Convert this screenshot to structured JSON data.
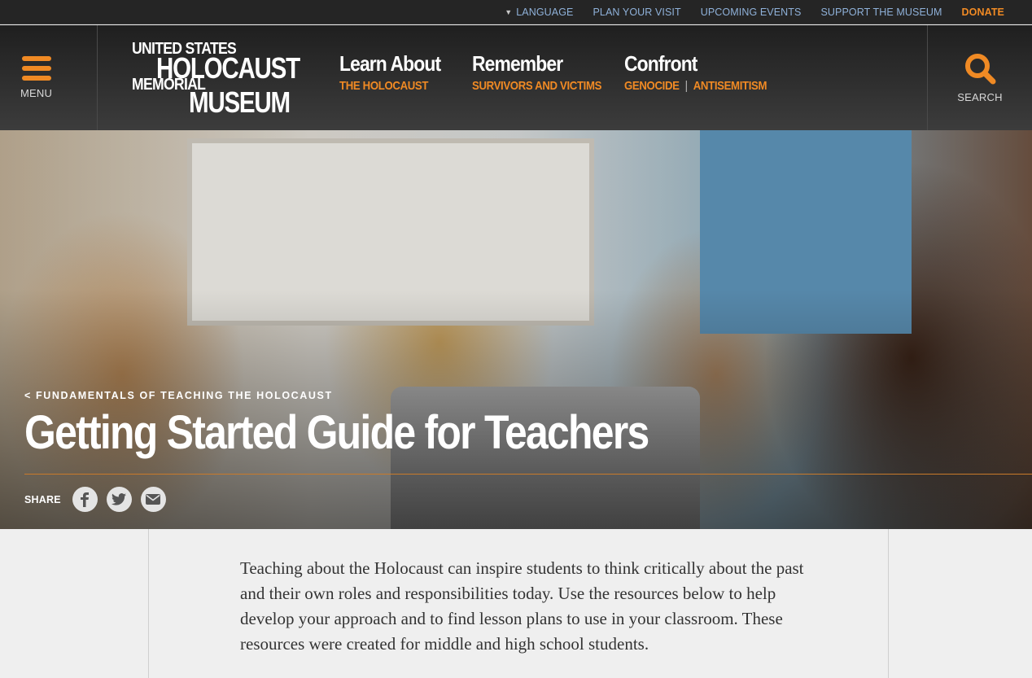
{
  "utility": {
    "language": "LANGUAGE",
    "plan_visit": "PLAN YOUR VISIT",
    "events": "UPCOMING EVENTS",
    "support": "SUPPORT THE MUSEUM",
    "donate": "DONATE"
  },
  "header": {
    "menu_label": "MENU",
    "search_label": "SEARCH",
    "logo": {
      "line1": "UNITED STATES",
      "line2": "HOLOCAUST",
      "line3": "MEMORIAL",
      "line4": "MUSEUM"
    },
    "nav": [
      {
        "title": "Learn About",
        "sub": "THE HOLOCAUST"
      },
      {
        "title": "Remember",
        "sub": "SURVIVORS AND VICTIMS"
      },
      {
        "title": "Confront",
        "sub1": "GENOCIDE",
        "sep": "|",
        "sub2": "ANTISEMITISM"
      }
    ]
  },
  "hero": {
    "breadcrumb": "< FUNDAMENTALS OF TEACHING THE HOLOCAUST",
    "title": "Getting Started Guide for Teachers",
    "share_label": "SHARE"
  },
  "content": {
    "intro": "Teaching about the Holocaust can inspire students to think critically about the past and their own roles and responsibilities today. Use the resources below to help develop your approach and to find lesson plans to use in your classroom. These resources were created for middle and high school students."
  },
  "colors": {
    "accent": "#f08a24",
    "link_blue": "#8fb1d9",
    "header_dark": "#252525"
  }
}
